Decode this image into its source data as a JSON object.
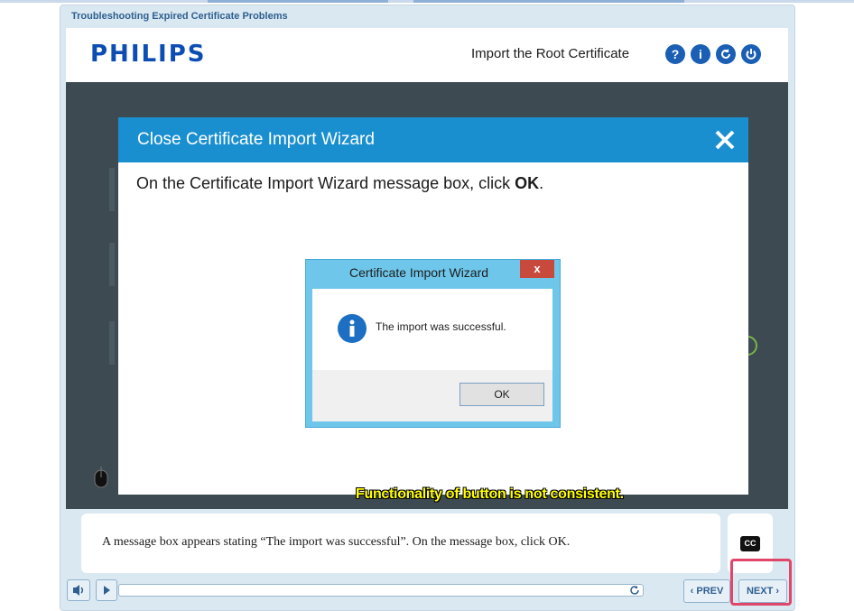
{
  "course_title": "Troubleshooting Expired Certificate Problems",
  "header": {
    "logo": "PHILIPS",
    "title": "Import the Root Certificate",
    "buttons": [
      {
        "icon": "help-icon",
        "glyph": "?"
      },
      {
        "icon": "info-icon",
        "glyph": "i"
      },
      {
        "icon": "replay-icon",
        "glyph": ""
      },
      {
        "icon": "power-icon",
        "glyph": ""
      }
    ]
  },
  "dialog": {
    "title": "Close Certificate Import Wizard",
    "instruction_prefix": "On the Certificate Import Wizard message box, click ",
    "instruction_bold": "OK",
    "instruction_suffix": "."
  },
  "message_box": {
    "title": "Certificate Import Wizard",
    "close_glyph": "x",
    "message": "The import was successful.",
    "ok_label": "OK"
  },
  "annotation": "Functionality of button is not consistent.",
  "caption": "A message box appears stating “The import was successful”. On the message box, click OK.",
  "cc_label": "CC",
  "controls": {
    "prev_label": "PREV",
    "next_label": "NEXT"
  },
  "colors": {
    "accent": "#1a8fd0",
    "brand": "#0b4db3",
    "highlight": "#e0466a",
    "annotation": "#ffff00"
  }
}
